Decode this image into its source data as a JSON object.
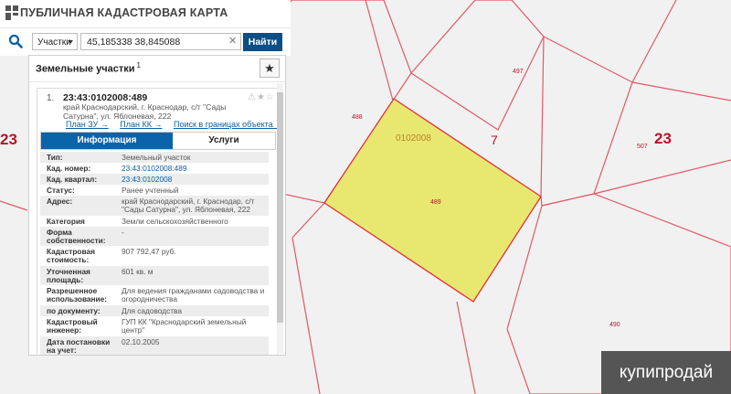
{
  "app": {
    "title": "ПУБЛИЧНАЯ КАДАСТРОВАЯ КАРТА",
    "logo_icon": "pkk-logo-icon"
  },
  "search": {
    "type_label": "Участки",
    "query": "45,185338 38,845088",
    "find_label": "Найти"
  },
  "panel": {
    "title": "Земельные участки",
    "count": "1",
    "bookmark_icon": "★",
    "card": {
      "number": "1.",
      "cad_number": "23:43:0102008:489",
      "icons": "⚠★☆",
      "address": "край Краснодарский, г. Краснодар, с/т \"Сады Сатурна\", ул. Яблоневая, 222",
      "links": [
        "План ЗУ →",
        "План КК →",
        "Поиск в границах объекта →"
      ],
      "tabs": {
        "info": "Информация",
        "services": "Услуги"
      },
      "attributes": [
        {
          "key": "Тип:",
          "value": "Земельный участок"
        },
        {
          "key": "Кад. номер:",
          "value": "23:43:0102008:489",
          "link": true
        },
        {
          "key": "Кад. квартал:",
          "value": "23:43:0102008",
          "link": true
        },
        {
          "key": "Статус:",
          "value": "Ранее учтенный"
        },
        {
          "key": "Адрес:",
          "value": "край Краснодарский, г. Краснодар, с/т \"Сады Сатурна\", ул. Яблоневая, 222"
        },
        {
          "key": "Категория земель:",
          "value": "Земли сельскохозяйственного назначения"
        },
        {
          "key": "Форма собственности:",
          "value": "-"
        },
        {
          "key": "Кадастровая стоимость:",
          "value": "907 792,47 руб."
        },
        {
          "key": "Уточненная площадь:",
          "value": "601 кв. м"
        },
        {
          "key": "Разрешенное использование:",
          "value": "Для ведения гражданами садоводства и огородничества"
        },
        {
          "key": "по документу:",
          "value": "Для садоводства"
        },
        {
          "key": "Кадастровый инженер:",
          "value": "ГУП КК \"Краснодарский земельный центр\""
        },
        {
          "key": "Дата постановки на учет:",
          "value": "02.10.2005"
        }
      ]
    }
  },
  "map": {
    "labels": {
      "left_block": "23",
      "right_block": "23",
      "block_7": "7",
      "quarter": "0102008",
      "parcel_489": "489",
      "parcel_488": "488",
      "parcel_497": "497",
      "parcel_507": "507",
      "parcel_490": "490"
    },
    "colors": {
      "parcel_fill": "#e8e870",
      "parcel_line": "#e0303a",
      "boundary": "#e05a66",
      "label": "#b01825"
    }
  },
  "watermark": "купипродай"
}
